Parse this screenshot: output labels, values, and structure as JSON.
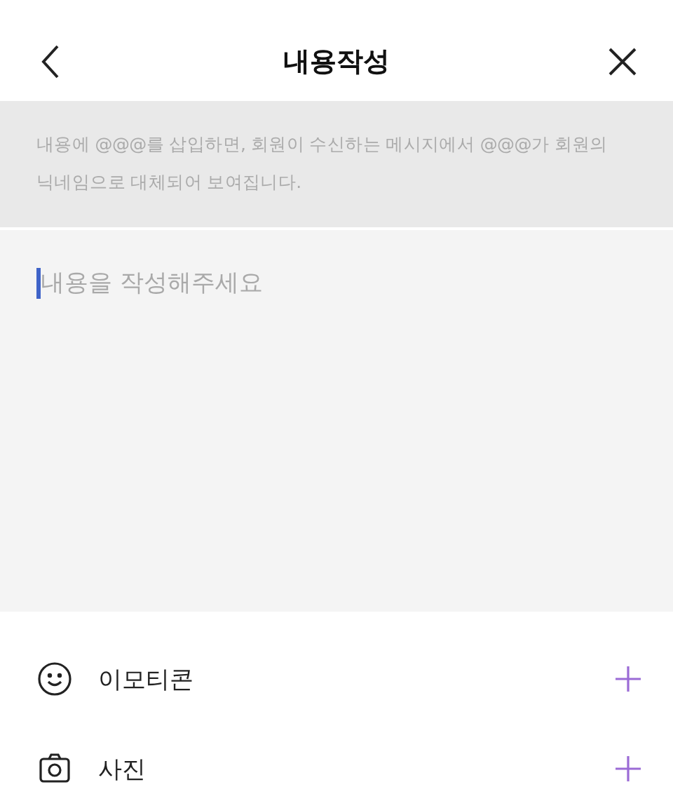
{
  "header": {
    "title": "내용작성"
  },
  "notice": "내용에 @@@를 삽입하면, 회원이 수신하는 메시지에서 @@@가 회원의 닉네임으로 대체되어 보여집니다.",
  "editor": {
    "placeholder": "내용을 작성해주세요",
    "focused": true
  },
  "attachments": [
    {
      "kind": "emoticon",
      "label": "이모티콘"
    },
    {
      "kind": "photo",
      "label": "사진"
    }
  ]
}
